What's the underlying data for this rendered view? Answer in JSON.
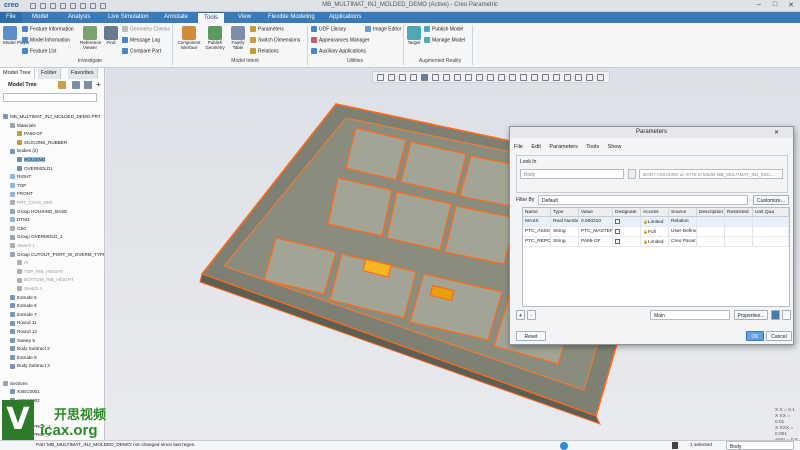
{
  "app": {
    "logo": "creo",
    "window_title": "MB_MULTIMAT_INJ_MOLDED_DEMO (Active) - Creo Parametric",
    "window_controls": [
      "–",
      "□",
      "✕"
    ]
  },
  "ribbon_tabs": [
    "File",
    "Model",
    "Analysis",
    "Live Simulation",
    "Annotate",
    "Tools",
    "View",
    "Flexible Modeling",
    "Applications"
  ],
  "active_tab": "Tools",
  "ribbon": {
    "model_player": "Model Player",
    "feature_information": "Feature Information",
    "model_information": "Model Information",
    "feature_list": "Feature List",
    "reference_viewer": "Reference Viewer",
    "find": "Find",
    "geometry_checks": "Geometry Checks",
    "message_log": "Message Log",
    "compare_part": "Compare Part",
    "investigate_group": "Investigate",
    "component_interface": "Component Interface",
    "publish_geometry": "Publish Geometry",
    "family_table": "Family Table",
    "parameters": "Parameters",
    "switch_dimensions": "Switch Dimensions",
    "relations": "Relations",
    "model_intent_group": "Model Intent",
    "udf_library": "UDF Library",
    "appearances_manager": "Appearances Manager",
    "auxiliary_applications": "Auxiliary Applications",
    "image_editor": "Image Editor",
    "utilities_group": "Utilities",
    "target": "Target",
    "publish_model": "Publish Model",
    "manage_model": "Manage Model",
    "augmented_reality_group": "Augmented Reality"
  },
  "left_panel": {
    "tabs": [
      "Model Tree",
      "Folder",
      "Favorites"
    ],
    "header": "Model Tree",
    "tree": [
      {
        "label": "MB_MULTIMAT_INJ_MOLDED_DEMO.PRT",
        "indent": 0,
        "icon": "#7a95b8"
      },
      {
        "label": "Materials",
        "indent": 1,
        "icon": "#9aa4ae"
      },
      {
        "label": "PA66-GF",
        "indent": 2,
        "icon": "#c89a3a"
      },
      {
        "label": "SILICONE_RUBBER",
        "indent": 2,
        "icon": "#c89a3a"
      },
      {
        "label": "Bodies (2)",
        "indent": 1,
        "icon": "#7a95b8"
      },
      {
        "label": "HOUSING",
        "indent": 2,
        "icon": "#6c8eb4",
        "selected": true
      },
      {
        "label": "OVERMOLD1",
        "indent": 2,
        "icon": "#6c8eb4"
      },
      {
        "label": "RIGHT",
        "indent": 1,
        "icon": "#8fb5da"
      },
      {
        "label": "TOP",
        "indent": 1,
        "icon": "#8fb5da"
      },
      {
        "label": "FRONT",
        "indent": 1,
        "icon": "#8fb5da"
      },
      {
        "label": "PRT_CSYS_DEF",
        "indent": 1,
        "icon": "#b0b0b0",
        "grey": true
      },
      {
        "label": "Group HOUSING_BASE",
        "indent": 1,
        "icon": "#9aa4ae"
      },
      {
        "label": "DTM3",
        "indent": 1,
        "icon": "#8fb5da"
      },
      {
        "label": "CS0",
        "indent": 1,
        "icon": "#b0b0b0"
      },
      {
        "label": "Group OVERMOLD_1",
        "indent": 1,
        "icon": "#9aa4ae"
      },
      {
        "label": "Sketch 1",
        "indent": 1,
        "icon": "#b0b0b0",
        "grey": true
      },
      {
        "label": "Group CUTOUT_PORT_W_OVERM_TYPE",
        "indent": 1,
        "icon": "#9aa4ae"
      },
      {
        "label": "r0",
        "indent": 2,
        "icon": "#b0b0b0",
        "grey": true
      },
      {
        "label": "TOP_RIB_HEIGHT",
        "indent": 2,
        "icon": "#b0b0b0",
        "grey": true
      },
      {
        "label": "BOTTOM_RIB_HEIGHT",
        "indent": 2,
        "icon": "#b0b0b0",
        "grey": true
      },
      {
        "label": "Sketch 4",
        "indent": 2,
        "icon": "#b0b0b0",
        "grey": true
      },
      {
        "label": "Extrude 5",
        "indent": 1,
        "icon": "#7a95b8"
      },
      {
        "label": "Extrude 6",
        "indent": 1,
        "icon": "#7a95b8"
      },
      {
        "label": "Extrude 7",
        "indent": 1,
        "icon": "#7a95b8"
      },
      {
        "label": "Round 11",
        "indent": 1,
        "icon": "#7a95b8"
      },
      {
        "label": "Round 12",
        "indent": 1,
        "icon": "#7a95b8"
      },
      {
        "label": "Sweep 5",
        "indent": 1,
        "icon": "#7a95b8"
      },
      {
        "label": "Body Subtract 2",
        "indent": 1,
        "icon": "#7a95b8"
      },
      {
        "label": "Extrude 8",
        "indent": 1,
        "icon": "#7a95b8"
      },
      {
        "label": "Body Subtract 3",
        "indent": 1,
        "icon": "#7a95b8"
      },
      {
        "label": "",
        "indent": 0,
        "icon": ""
      },
      {
        "label": "Sections",
        "indent": 0,
        "icon": "#9aa4ae"
      },
      {
        "label": "XSEC0001",
        "indent": 1,
        "icon": "#7a95b8"
      },
      {
        "label": "XSEC0002",
        "indent": 1,
        "icon": "#7a95b8"
      },
      {
        "label": "",
        "indent": 0,
        "icon": ""
      },
      {
        "label": "Footer",
        "indent": 0,
        "icon": "#9aa4ae"
      },
      {
        "label": "MOLD_PROF_1",
        "indent": 1,
        "icon": "#7a95b8"
      },
      {
        "label": "MOLD_PROF_2",
        "indent": 1,
        "icon": "#7a95b8"
      }
    ]
  },
  "dialog": {
    "title": "Parameters",
    "menu": [
      "File",
      "Edit",
      "Parameters",
      "Tools",
      "Show"
    ],
    "look_in_label": "Look In",
    "look_in_type": "Body",
    "look_in_value": "BODY HOUSING id -5778 of Model MB_MULTIMAT_INJ_MOL...",
    "filter_label": "Filter By",
    "filter_value": "Default",
    "customize_button": "Customize...",
    "columns": [
      "Name",
      "Type",
      "Value",
      "Designate",
      "Access",
      "Source",
      "Description",
      "Restricted",
      "Unit Qua"
    ],
    "rows": [
      [
        "MASS",
        "Real Number",
        "0.000210",
        "",
        "Limited",
        "Relation",
        "",
        "",
        ""
      ],
      [
        "PTC_ASSIGNED",
        "String",
        "PTC_MASTER",
        "",
        "Full",
        "User-Defined",
        "",
        "",
        ""
      ],
      [
        "PTC_REPORT",
        "String",
        "PA66-GF",
        "",
        "Limited",
        "Creo Param",
        "",
        "",
        ""
      ]
    ],
    "main_select": "Main",
    "properties_button": "Properties...",
    "reset_button": "Reset",
    "ok_button": "OK",
    "cancel_button": "Cancel"
  },
  "status": {
    "message": "Part 'MB_MULTIMAT_INJ_MOLDED_DEMO' not changed since last regen.",
    "selected": "1 selected",
    "filter": "Body"
  },
  "coords": [
    "X X = 0.1",
    "X XX = 0.01",
    "X XXX = 0.001",
    "ANG = 0.5"
  ],
  "watermark": {
    "logo_letter": "V",
    "line1": "开思视频",
    "line2": "icax.org"
  },
  "colors": {
    "accent": "#3a7ab8",
    "highlight": "#ff6a1a",
    "model_fill": "#7d8072"
  }
}
